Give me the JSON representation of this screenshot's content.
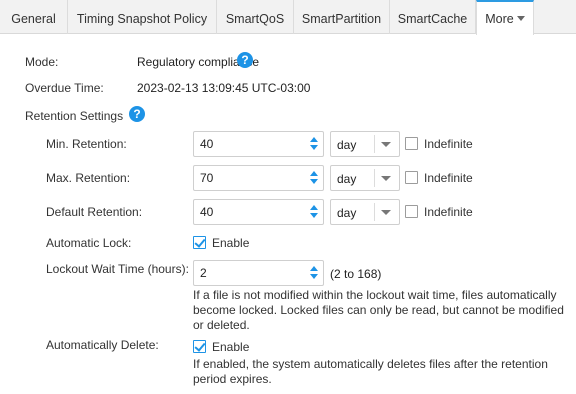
{
  "tabs": [
    {
      "label": "General",
      "active": false
    },
    {
      "label": "Timing Snapshot Policy",
      "active": false
    },
    {
      "label": "SmartQoS",
      "active": false
    },
    {
      "label": "SmartPartition",
      "active": false
    },
    {
      "label": "SmartCache",
      "active": false
    },
    {
      "label": "More",
      "active": true
    }
  ],
  "mode": {
    "label": "Mode:",
    "value": "Regulatory compliance"
  },
  "overdue": {
    "label": "Overdue Time:",
    "value": "2023-02-13 13:09:45 UTC-03:00"
  },
  "retention": {
    "heading": "Retention Settings",
    "help_glyph": "?",
    "min": {
      "label": "Min. Retention:",
      "value": "40",
      "unit": "day",
      "indefinite_label": "Indefinite",
      "indefinite": false
    },
    "max": {
      "label": "Max. Retention:",
      "value": "70",
      "unit": "day",
      "indefinite_label": "Indefinite",
      "indefinite": false
    },
    "default": {
      "label": "Default Retention:",
      "value": "40",
      "unit": "day",
      "indefinite_label": "Indefinite",
      "indefinite": false
    },
    "auto_lock": {
      "label": "Automatic Lock:",
      "checkbox_label": "Enable",
      "checked": true
    },
    "lockout": {
      "label": "Lockout Wait Time (hours):",
      "value": "2",
      "range": "(2 to 168)",
      "description": "If a file is not modified within the lockout wait time, files automatically become locked. Locked files can only be read, but cannot be modified or deleted."
    },
    "auto_delete": {
      "label": "Automatically Delete:",
      "checkbox_label": "Enable",
      "checked": true,
      "description": "If enabled, the system automatically deletes files after the retention period expires."
    }
  },
  "colors": {
    "accent": "#1d93e6",
    "tab_active_border": "#2d9be2",
    "tabbar_bg": "#f2f2f2"
  }
}
